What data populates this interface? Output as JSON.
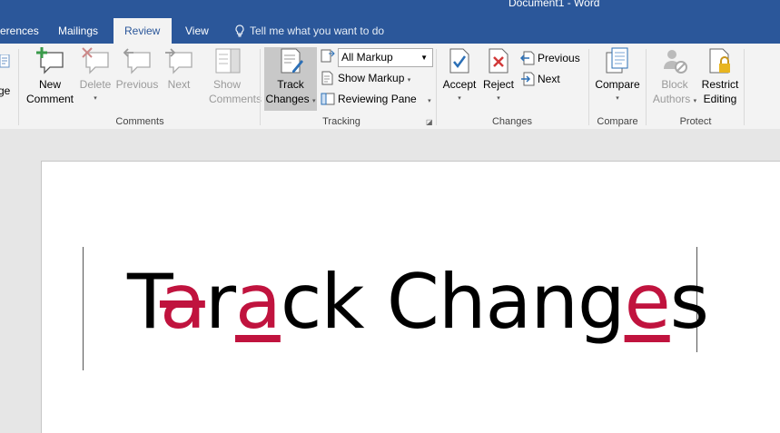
{
  "window": {
    "title": "Document1 - Word"
  },
  "tabs": [
    {
      "label": "erences"
    },
    {
      "label": "Mailings"
    },
    {
      "label": "Review"
    },
    {
      "label": "View"
    }
  ],
  "tell_me": "Tell me what you want to do",
  "ribbon": {
    "proofing_partial": "ge",
    "comments": {
      "label": "Comments",
      "new": [
        "New",
        "Comment"
      ],
      "delete": "Delete",
      "previous": "Previous",
      "next": "Next",
      "show": [
        "Show",
        "Comments"
      ]
    },
    "tracking": {
      "label": "Tracking",
      "track_changes": [
        "Track",
        "Changes"
      ],
      "markup_value": "All Markup",
      "show_markup": "Show Markup",
      "reviewing_pane": "Reviewing Pane"
    },
    "changes": {
      "label": "Changes",
      "accept": "Accept",
      "reject": "Reject",
      "previous": "Previous",
      "next": "Next"
    },
    "compare": {
      "label": "Compare",
      "compare": "Compare"
    },
    "protect": {
      "label": "Protect",
      "block": [
        "Block",
        "Authors"
      ],
      "restrict": [
        "Restrict",
        "Editing"
      ]
    }
  },
  "document": {
    "segments": [
      {
        "text": "T",
        "type": "normal"
      },
      {
        "text": "a",
        "type": "deleted"
      },
      {
        "text": "r",
        "type": "normal"
      },
      {
        "text": "a",
        "type": "inserted"
      },
      {
        "text": "ck Chang",
        "type": "normal"
      },
      {
        "text": "e",
        "type": "inserted"
      },
      {
        "text": "s",
        "type": "normal"
      }
    ]
  },
  "colors": {
    "accent": "#2b579a",
    "revision": "#c0133e"
  }
}
